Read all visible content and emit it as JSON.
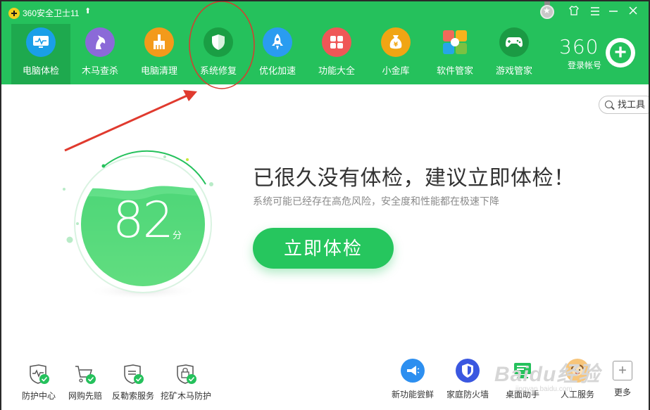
{
  "titlebar": {
    "title": "360安全卫士11",
    "upgrade_icon": "arrow-up-icon"
  },
  "window_controls": [
    "medal-icon",
    "skin-icon",
    "menu-icon",
    "minimize-icon",
    "close-icon"
  ],
  "nav": {
    "items": [
      {
        "label": "电脑体检",
        "icon": "monitor-icon",
        "color": "#1a9fe8",
        "active": true
      },
      {
        "label": "木马查杀",
        "icon": "horse-icon",
        "color": "#8b6ad8"
      },
      {
        "label": "电脑清理",
        "icon": "broom-icon",
        "color": "#f39a1b"
      },
      {
        "label": "系统修复",
        "icon": "shield-icon",
        "color": "#1fa349"
      },
      {
        "label": "优化加速",
        "icon": "rocket-icon",
        "color": "#2a9cf0"
      },
      {
        "label": "功能大全",
        "icon": "grid-icon",
        "color": "#ef5757"
      },
      {
        "label": "小金库",
        "icon": "money-bag-icon",
        "color": "#f0a513"
      },
      {
        "label": "软件管家",
        "icon": "apps-icon",
        "color": "#f46b5b"
      },
      {
        "label": "游戏管家",
        "icon": "gamepad-icon",
        "color": "#1b9a44"
      }
    ]
  },
  "account": {
    "logo": "360",
    "login_label": "登录帐号"
  },
  "find_tools": {
    "label": "找工具"
  },
  "score": {
    "value": "82",
    "unit": "分"
  },
  "main": {
    "headline": "已很久没有体检，建议立即体检！",
    "subline": "系统可能已经存在高危风险，安全度和性能都在极速下降",
    "check_button": "立即体检"
  },
  "protections": [
    {
      "label": "防护中心",
      "icon": "heartbeat-shield-icon"
    },
    {
      "label": "网购先赔",
      "icon": "cart-icon"
    },
    {
      "label": "反勒索服务",
      "icon": "shield-doc-icon"
    },
    {
      "label": "挖矿木马防护",
      "icon": "lock-shield-icon"
    }
  ],
  "tools": [
    {
      "label": "新功能尝鲜",
      "icon": "megaphone-icon",
      "color": "#2d8ff0"
    },
    {
      "label": "家庭防火墙",
      "icon": "firewall-icon",
      "color": "#3a57e0"
    },
    {
      "label": "桌面助手",
      "icon": "desktop-icon",
      "color": "#25c15c"
    },
    {
      "label": "人工服务",
      "icon": "support-icon",
      "color": "#f0a040"
    },
    {
      "label": "更多",
      "icon": "plus-icon"
    }
  ],
  "watermark": {
    "text": "Baidu经验",
    "sub": "jingyan.baidu.com"
  }
}
